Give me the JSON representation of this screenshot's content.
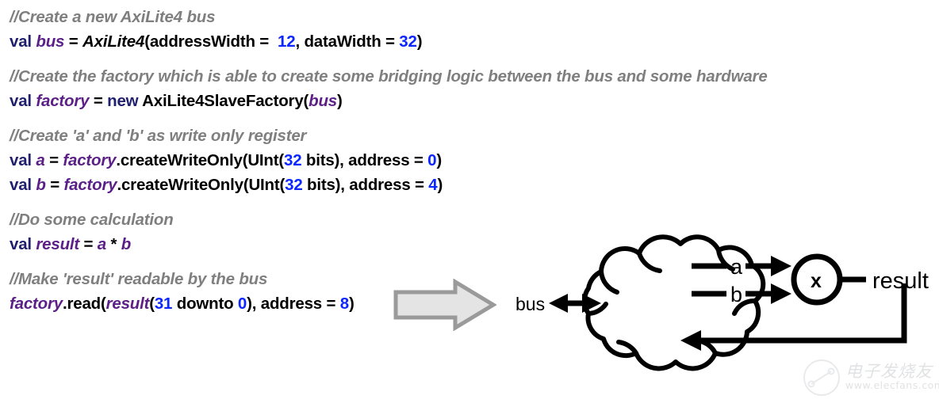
{
  "code": {
    "blocks": [
      {
        "comment": "//Create a new AxiLite4 bus",
        "lines": [
          {
            "tokens": [
              {
                "t": "val ",
                "s": "kw"
              },
              {
                "t": "bus",
                "s": "var"
              },
              {
                "t": " = ",
                "s": "pln"
              },
              {
                "t": "AxiLite4",
                "s": "typ"
              },
              {
                "t": "(addressWidth = ",
                "s": "pln"
              },
              {
                "t": " 12",
                "s": "num"
              },
              {
                "t": ", dataWidth = ",
                "s": "pln"
              },
              {
                "t": "32",
                "s": "num"
              },
              {
                "t": ")",
                "s": "pln"
              }
            ]
          }
        ]
      },
      {
        "comment": "//Create the factory which is able to create some bridging logic between the bus and some hardware",
        "lines": [
          {
            "tokens": [
              {
                "t": "val ",
                "s": "kw"
              },
              {
                "t": "factory",
                "s": "var"
              },
              {
                "t": " = ",
                "s": "pln"
              },
              {
                "t": "new",
                "s": "kw"
              },
              {
                "t": " AxiLite4SlaveFactory(",
                "s": "pln"
              },
              {
                "t": "bus",
                "s": "var"
              },
              {
                "t": ")",
                "s": "pln"
              }
            ]
          }
        ]
      },
      {
        "comment": "//Create 'a' and 'b' as write only register",
        "lines": [
          {
            "tokens": [
              {
                "t": "val ",
                "s": "kw"
              },
              {
                "t": "a",
                "s": "var"
              },
              {
                "t": " = ",
                "s": "pln"
              },
              {
                "t": "factory",
                "s": "var"
              },
              {
                "t": ".createWriteOnly(UInt(",
                "s": "pln"
              },
              {
                "t": "32",
                "s": "num"
              },
              {
                "t": " bits), address = ",
                "s": "pln"
              },
              {
                "t": "0",
                "s": "num"
              },
              {
                "t": ")",
                "s": "pln"
              }
            ]
          },
          {
            "tokens": [
              {
                "t": "val ",
                "s": "kw"
              },
              {
                "t": "b",
                "s": "var"
              },
              {
                "t": " = ",
                "s": "pln"
              },
              {
                "t": "factory",
                "s": "var"
              },
              {
                "t": ".createWriteOnly(UInt(",
                "s": "pln"
              },
              {
                "t": "32",
                "s": "num"
              },
              {
                "t": " bits), address = ",
                "s": "pln"
              },
              {
                "t": "4",
                "s": "num"
              },
              {
                "t": ")",
                "s": "pln"
              }
            ]
          }
        ]
      },
      {
        "comment": "//Do some calculation",
        "lines": [
          {
            "tokens": [
              {
                "t": "val ",
                "s": "kw"
              },
              {
                "t": "result",
                "s": "var"
              },
              {
                "t": " = ",
                "s": "pln"
              },
              {
                "t": "a",
                "s": "var"
              },
              {
                "t": " * ",
                "s": "pln"
              },
              {
                "t": "b",
                "s": "var"
              }
            ]
          }
        ]
      },
      {
        "comment": "//Make 'result' readable by the bus",
        "lines": [
          {
            "tokens": [
              {
                "t": "factory",
                "s": "var"
              },
              {
                "t": ".read(",
                "s": "pln"
              },
              {
                "t": "result",
                "s": "var"
              },
              {
                "t": "(",
                "s": "pln"
              },
              {
                "t": "31",
                "s": "num"
              },
              {
                "t": " downto ",
                "s": "pln"
              },
              {
                "t": "0",
                "s": "num"
              },
              {
                "t": "), address = ",
                "s": "pln"
              },
              {
                "t": "8",
                "s": "num"
              },
              {
                "t": ")",
                "s": "pln"
              }
            ]
          }
        ]
      }
    ]
  },
  "diagram": {
    "bus_label": "bus",
    "signal_a_label": "a",
    "signal_b_label": "b",
    "operator_label": "x",
    "result_label": "result",
    "cloud_name": "hardware-cloud",
    "transition_arrow_name": "transition-arrow"
  },
  "watermark": {
    "chinese": "电子发烧友",
    "url": "www.elecfans.com"
  },
  "colors": {
    "comment": "#7f7f7f",
    "keyword": "#1f1f6e",
    "identifier": "#5b1f87",
    "plain": "#000000",
    "number": "#0b26ff",
    "diagram_stroke": "#000000",
    "arrow_fill": "#e4e4e4",
    "arrow_stroke": "#9a9a9a"
  }
}
